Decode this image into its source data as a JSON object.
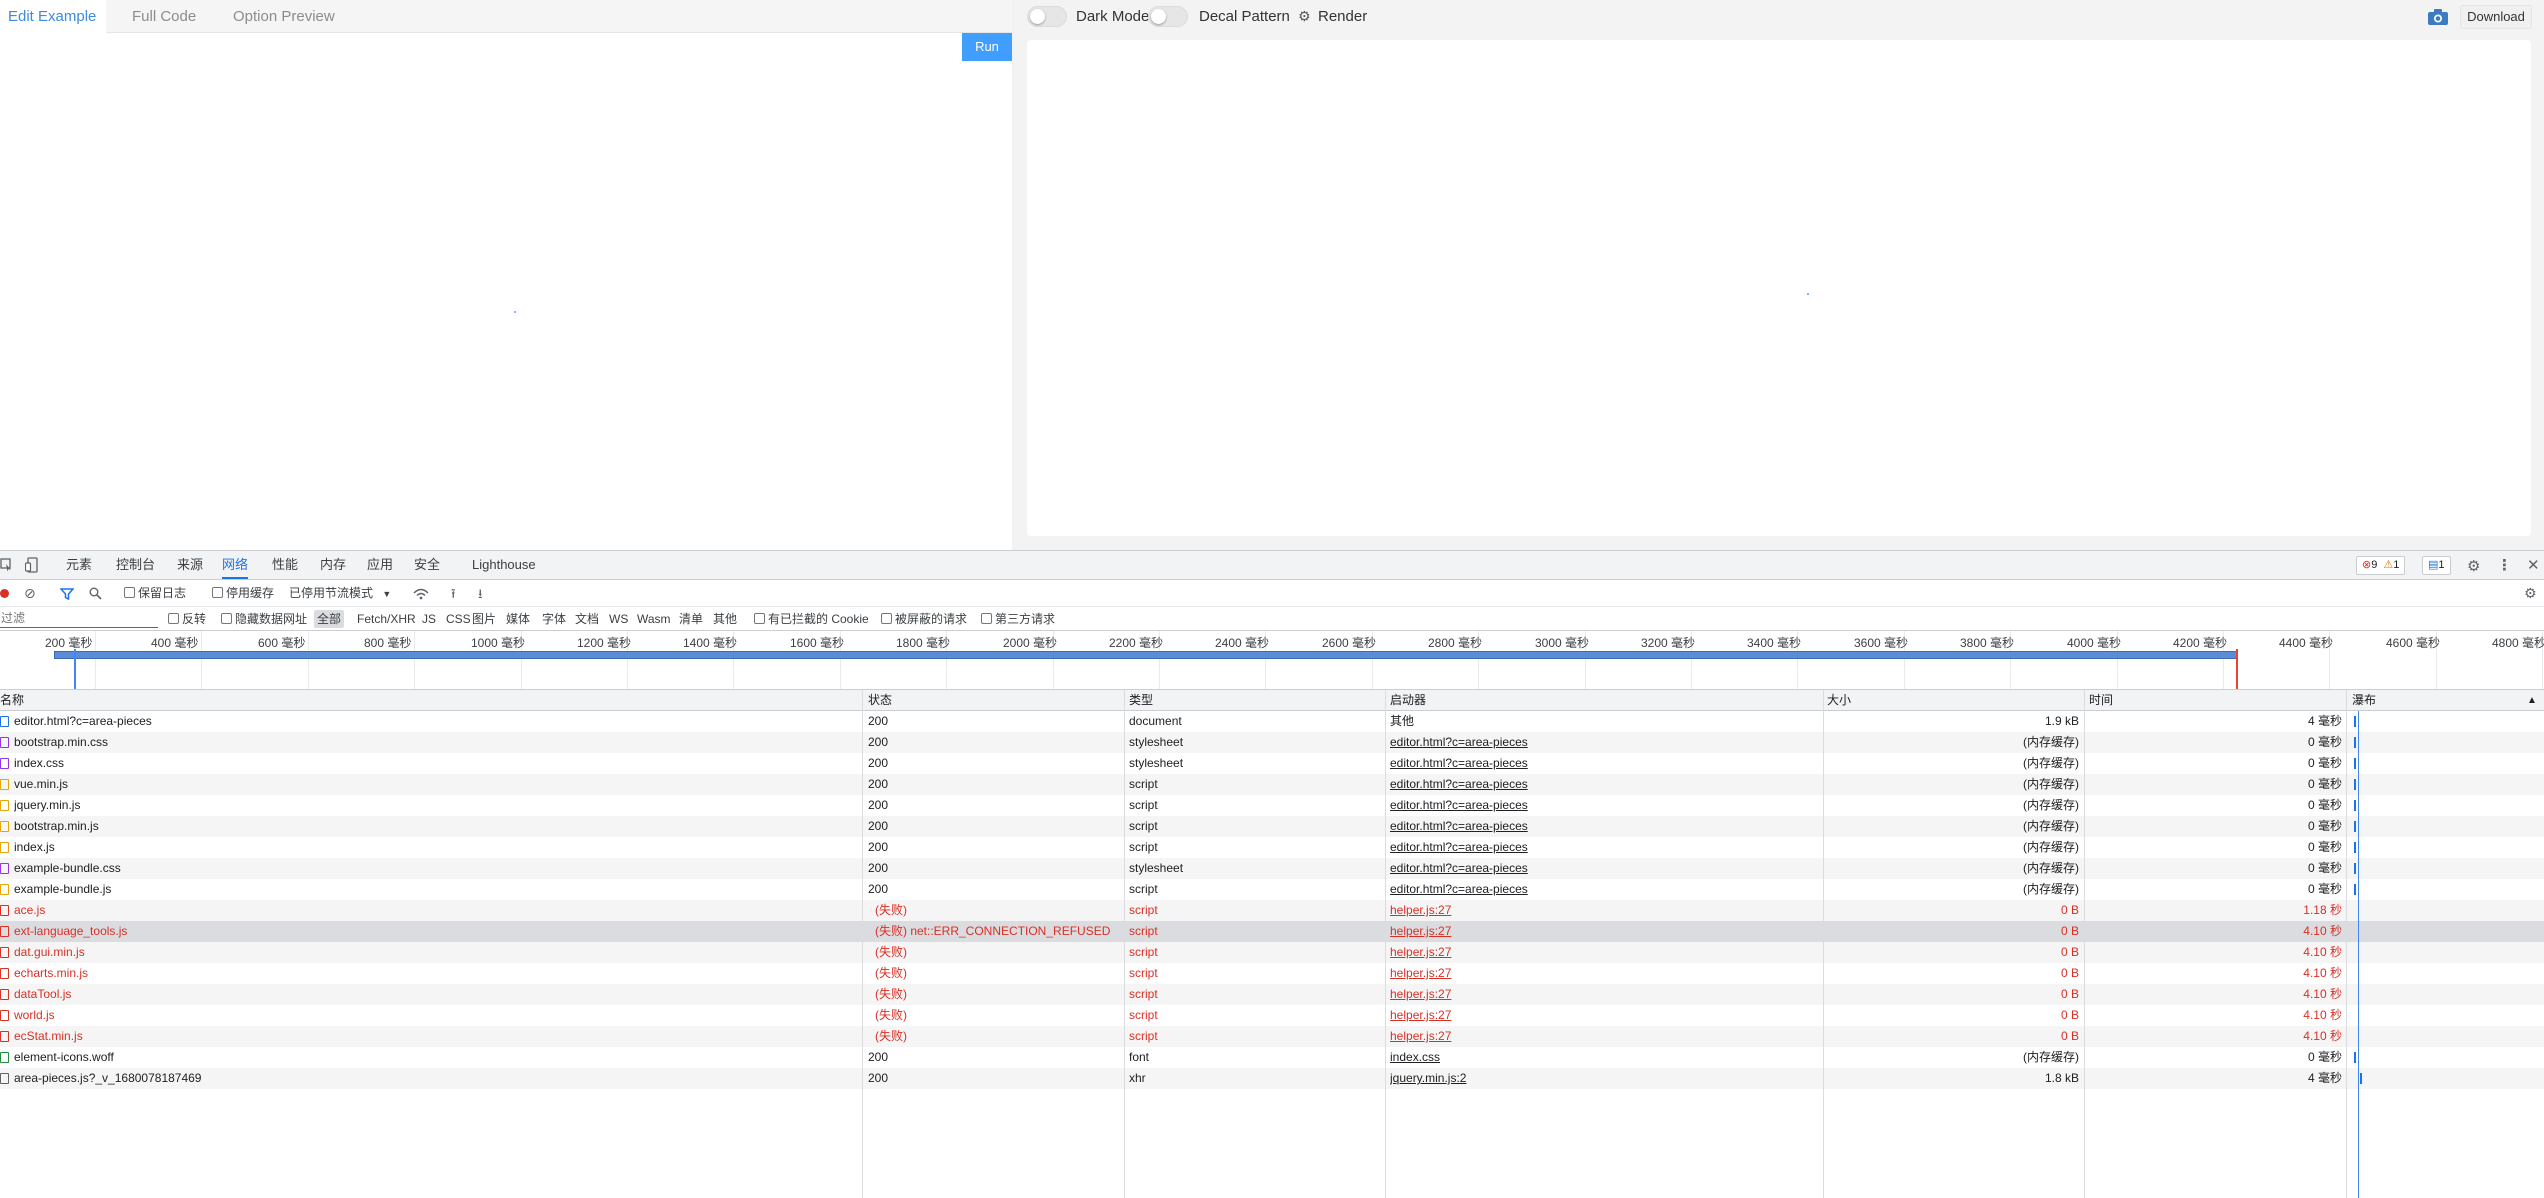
{
  "editor": {
    "tabs": [
      {
        "label": "Edit Example",
        "active": true
      },
      {
        "label": "Full Code",
        "active": false
      },
      {
        "label": "Option Preview",
        "active": false
      }
    ],
    "run_label": "Run"
  },
  "preview": {
    "dark_mode_label": "Dark Mode",
    "decal_label": "Decal Pattern",
    "render_label": "Render",
    "download_label": "Download"
  },
  "devtools": {
    "tabs": [
      "元素",
      "控制台",
      "来源",
      "网络",
      "性能",
      "内存",
      "应用",
      "安全",
      "Lighthouse"
    ],
    "active_tab": "网络",
    "error_count": "9",
    "warning_count": "1",
    "message_count": "1",
    "toolbar": {
      "preserve_log": "保留日志",
      "disable_cache": "停用缓存",
      "throttling": "已停用节流模式"
    },
    "filter": {
      "placeholder": "过滤",
      "invert": "反转",
      "hide_data_urls": "隐藏数据网址",
      "types": [
        "全部",
        "Fetch/XHR",
        "JS",
        "CSS",
        "图片",
        "媒体",
        "字体",
        "文档",
        "WS",
        "Wasm",
        "清单",
        "其他"
      ],
      "blocked_cookies": "有已拦截的 Cookie",
      "blocked_requests": "被屏蔽的请求",
      "third_party": "第三方请求"
    },
    "overview_ticks": [
      "200 毫秒",
      "400 毫秒",
      "600 毫秒",
      "800 毫秒",
      "1000 毫秒",
      "1200 毫秒",
      "1400 毫秒",
      "1600 毫秒",
      "1800 毫秒",
      "2000 毫秒",
      "2200 毫秒",
      "2400 毫秒",
      "2600 毫秒",
      "2800 毫秒",
      "3000 毫秒",
      "3200 毫秒",
      "3400 毫秒",
      "3600 毫秒",
      "3800 毫秒",
      "4000 毫秒",
      "4200 毫秒",
      "4400 毫秒",
      "4600 毫秒",
      "4800 毫秒"
    ],
    "columns": {
      "name": "名称",
      "status": "状态",
      "type": "类型",
      "initiator": "启动器",
      "size": "大小",
      "time": "时间",
      "waterfall": "瀑布"
    },
    "requests": [
      {
        "name": "editor.html?c=area-pieces",
        "status": "200",
        "type": "document",
        "initiator": "其他",
        "size": "1.9 kB",
        "time": "4 毫秒",
        "error": false
      },
      {
        "name": "bootstrap.min.css",
        "status": "200",
        "type": "stylesheet",
        "initiator": "editor.html?c=area-pieces",
        "size": "(内存缓存)",
        "time": "0 毫秒",
        "error": false
      },
      {
        "name": "index.css",
        "status": "200",
        "type": "stylesheet",
        "initiator": "editor.html?c=area-pieces",
        "size": "(内存缓存)",
        "time": "0 毫秒",
        "error": false
      },
      {
        "name": "vue.min.js",
        "status": "200",
        "type": "script",
        "initiator": "editor.html?c=area-pieces",
        "size": "(内存缓存)",
        "time": "0 毫秒",
        "error": false
      },
      {
        "name": "jquery.min.js",
        "status": "200",
        "type": "script",
        "initiator": "editor.html?c=area-pieces",
        "size": "(内存缓存)",
        "time": "0 毫秒",
        "error": false
      },
      {
        "name": "bootstrap.min.js",
        "status": "200",
        "type": "script",
        "initiator": "editor.html?c=area-pieces",
        "size": "(内存缓存)",
        "time": "0 毫秒",
        "error": false
      },
      {
        "name": "index.js",
        "status": "200",
        "type": "script",
        "initiator": "editor.html?c=area-pieces",
        "size": "(内存缓存)",
        "time": "0 毫秒",
        "error": false
      },
      {
        "name": "example-bundle.css",
        "status": "200",
        "type": "stylesheet",
        "initiator": "editor.html?c=area-pieces",
        "size": "(内存缓存)",
        "time": "0 毫秒",
        "error": false
      },
      {
        "name": "example-bundle.js",
        "status": "200",
        "type": "script",
        "initiator": "editor.html?c=area-pieces",
        "size": "(内存缓存)",
        "time": "0 毫秒",
        "error": false
      },
      {
        "name": "ace.js",
        "status": "(失败)",
        "type": "script",
        "initiator": "helper.js:27",
        "size": "0 B",
        "time": "1.18 秒",
        "error": true
      },
      {
        "name": "ext-language_tools.js",
        "status": "(失败) net::ERR_CONNECTION_REFUSED",
        "type": "script",
        "initiator": "helper.js:27",
        "size": "0 B",
        "time": "4.10 秒",
        "error": true,
        "highlight": true
      },
      {
        "name": "dat.gui.min.js",
        "status": "(失败)",
        "type": "script",
        "initiator": "helper.js:27",
        "size": "0 B",
        "time": "4.10 秒",
        "error": true
      },
      {
        "name": "echarts.min.js",
        "status": "(失败)",
        "type": "script",
        "initiator": "helper.js:27",
        "size": "0 B",
        "time": "4.10 秒",
        "error": true
      },
      {
        "name": "dataTool.js",
        "status": "(失败)",
        "type": "script",
        "initiator": "helper.js:27",
        "size": "0 B",
        "time": "4.10 秒",
        "error": true
      },
      {
        "name": "world.js",
        "status": "(失败)",
        "type": "script",
        "initiator": "helper.js:27",
        "size": "0 B",
        "time": "4.10 秒",
        "error": true
      },
      {
        "name": "ecStat.min.js",
        "status": "(失败)",
        "type": "script",
        "initiator": "helper.js:27",
        "size": "0 B",
        "time": "4.10 秒",
        "error": true
      },
      {
        "name": "element-icons.woff",
        "status": "200",
        "type": "font",
        "initiator": "index.css",
        "size": "(内存缓存)",
        "time": "0 毫秒",
        "error": false
      },
      {
        "name": "area-pieces.js?_v_1680078187469",
        "status": "200",
        "type": "xhr",
        "initiator": "jquery.min.js:2",
        "size": "1.8 kB",
        "time": "4 毫秒",
        "error": false
      }
    ]
  },
  "colors": {
    "accent": "#409eff",
    "devtools_blue": "#1a73e8",
    "error_red": "#d93025"
  }
}
